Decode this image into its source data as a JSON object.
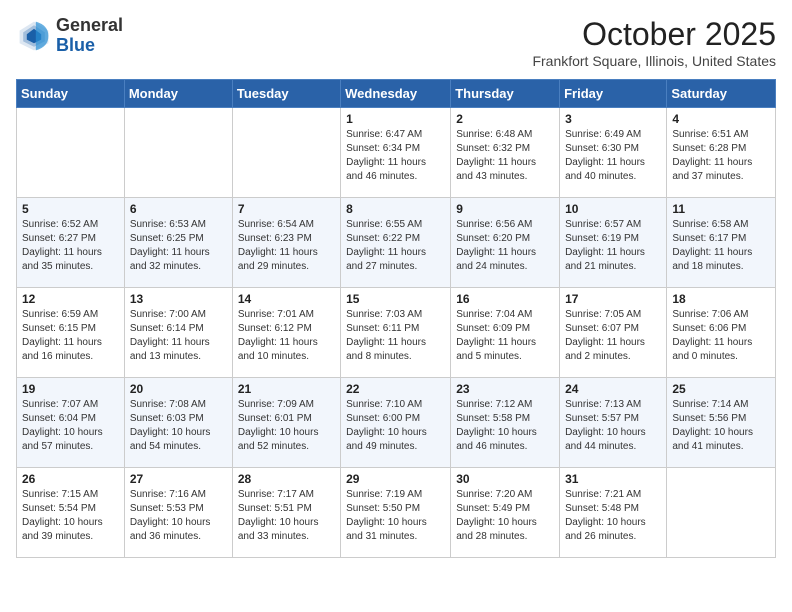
{
  "header": {
    "logo": {
      "line1": "General",
      "line2": "Blue"
    },
    "title": "October 2025",
    "subtitle": "Frankfort Square, Illinois, United States"
  },
  "weekdays": [
    "Sunday",
    "Monday",
    "Tuesday",
    "Wednesday",
    "Thursday",
    "Friday",
    "Saturday"
  ],
  "weeks": [
    [
      {
        "day": "",
        "info": ""
      },
      {
        "day": "",
        "info": ""
      },
      {
        "day": "",
        "info": ""
      },
      {
        "day": "1",
        "info": "Sunrise: 6:47 AM\nSunset: 6:34 PM\nDaylight: 11 hours and 46 minutes."
      },
      {
        "day": "2",
        "info": "Sunrise: 6:48 AM\nSunset: 6:32 PM\nDaylight: 11 hours and 43 minutes."
      },
      {
        "day": "3",
        "info": "Sunrise: 6:49 AM\nSunset: 6:30 PM\nDaylight: 11 hours and 40 minutes."
      },
      {
        "day": "4",
        "info": "Sunrise: 6:51 AM\nSunset: 6:28 PM\nDaylight: 11 hours and 37 minutes."
      }
    ],
    [
      {
        "day": "5",
        "info": "Sunrise: 6:52 AM\nSunset: 6:27 PM\nDaylight: 11 hours and 35 minutes."
      },
      {
        "day": "6",
        "info": "Sunrise: 6:53 AM\nSunset: 6:25 PM\nDaylight: 11 hours and 32 minutes."
      },
      {
        "day": "7",
        "info": "Sunrise: 6:54 AM\nSunset: 6:23 PM\nDaylight: 11 hours and 29 minutes."
      },
      {
        "day": "8",
        "info": "Sunrise: 6:55 AM\nSunset: 6:22 PM\nDaylight: 11 hours and 27 minutes."
      },
      {
        "day": "9",
        "info": "Sunrise: 6:56 AM\nSunset: 6:20 PM\nDaylight: 11 hours and 24 minutes."
      },
      {
        "day": "10",
        "info": "Sunrise: 6:57 AM\nSunset: 6:19 PM\nDaylight: 11 hours and 21 minutes."
      },
      {
        "day": "11",
        "info": "Sunrise: 6:58 AM\nSunset: 6:17 PM\nDaylight: 11 hours and 18 minutes."
      }
    ],
    [
      {
        "day": "12",
        "info": "Sunrise: 6:59 AM\nSunset: 6:15 PM\nDaylight: 11 hours and 16 minutes."
      },
      {
        "day": "13",
        "info": "Sunrise: 7:00 AM\nSunset: 6:14 PM\nDaylight: 11 hours and 13 minutes."
      },
      {
        "day": "14",
        "info": "Sunrise: 7:01 AM\nSunset: 6:12 PM\nDaylight: 11 hours and 10 minutes."
      },
      {
        "day": "15",
        "info": "Sunrise: 7:03 AM\nSunset: 6:11 PM\nDaylight: 11 hours and 8 minutes."
      },
      {
        "day": "16",
        "info": "Sunrise: 7:04 AM\nSunset: 6:09 PM\nDaylight: 11 hours and 5 minutes."
      },
      {
        "day": "17",
        "info": "Sunrise: 7:05 AM\nSunset: 6:07 PM\nDaylight: 11 hours and 2 minutes."
      },
      {
        "day": "18",
        "info": "Sunrise: 7:06 AM\nSunset: 6:06 PM\nDaylight: 11 hours and 0 minutes."
      }
    ],
    [
      {
        "day": "19",
        "info": "Sunrise: 7:07 AM\nSunset: 6:04 PM\nDaylight: 10 hours and 57 minutes."
      },
      {
        "day": "20",
        "info": "Sunrise: 7:08 AM\nSunset: 6:03 PM\nDaylight: 10 hours and 54 minutes."
      },
      {
        "day": "21",
        "info": "Sunrise: 7:09 AM\nSunset: 6:01 PM\nDaylight: 10 hours and 52 minutes."
      },
      {
        "day": "22",
        "info": "Sunrise: 7:10 AM\nSunset: 6:00 PM\nDaylight: 10 hours and 49 minutes."
      },
      {
        "day": "23",
        "info": "Sunrise: 7:12 AM\nSunset: 5:58 PM\nDaylight: 10 hours and 46 minutes."
      },
      {
        "day": "24",
        "info": "Sunrise: 7:13 AM\nSunset: 5:57 PM\nDaylight: 10 hours and 44 minutes."
      },
      {
        "day": "25",
        "info": "Sunrise: 7:14 AM\nSunset: 5:56 PM\nDaylight: 10 hours and 41 minutes."
      }
    ],
    [
      {
        "day": "26",
        "info": "Sunrise: 7:15 AM\nSunset: 5:54 PM\nDaylight: 10 hours and 39 minutes."
      },
      {
        "day": "27",
        "info": "Sunrise: 7:16 AM\nSunset: 5:53 PM\nDaylight: 10 hours and 36 minutes."
      },
      {
        "day": "28",
        "info": "Sunrise: 7:17 AM\nSunset: 5:51 PM\nDaylight: 10 hours and 33 minutes."
      },
      {
        "day": "29",
        "info": "Sunrise: 7:19 AM\nSunset: 5:50 PM\nDaylight: 10 hours and 31 minutes."
      },
      {
        "day": "30",
        "info": "Sunrise: 7:20 AM\nSunset: 5:49 PM\nDaylight: 10 hours and 28 minutes."
      },
      {
        "day": "31",
        "info": "Sunrise: 7:21 AM\nSunset: 5:48 PM\nDaylight: 10 hours and 26 minutes."
      },
      {
        "day": "",
        "info": ""
      }
    ]
  ]
}
